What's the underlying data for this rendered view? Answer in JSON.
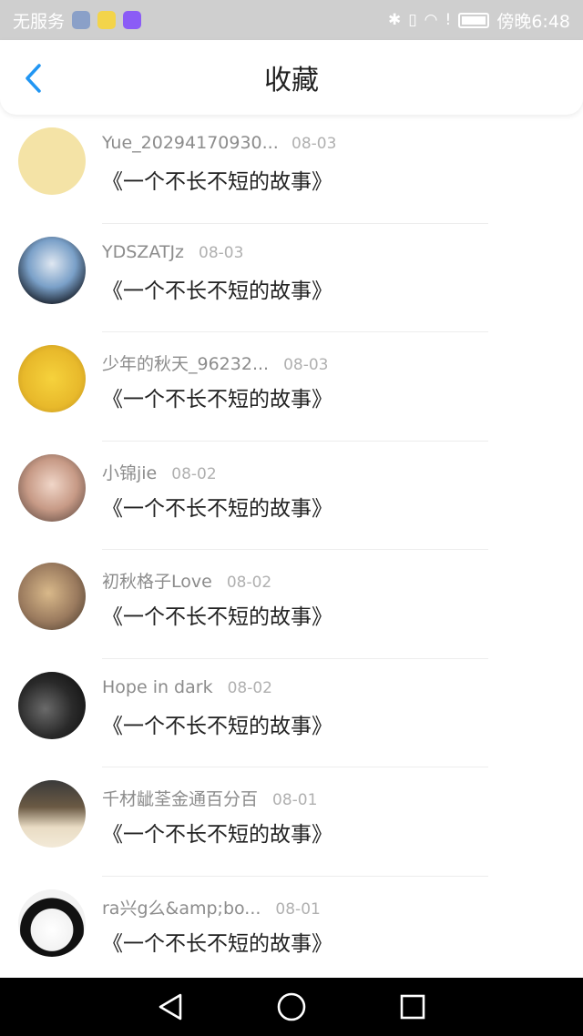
{
  "status_bar": {
    "carrier": "无服务",
    "time": "傍晚6:48",
    "icons": [
      "bluetooth-icon",
      "vibrate-icon",
      "wifi-icon",
      "alert-icon",
      "battery-icon"
    ]
  },
  "header": {
    "title": "收藏",
    "back_icon": "chevron-left-icon",
    "accent_color": "#2196f3"
  },
  "items": [
    {
      "username": "Yue_20294170930...",
      "date": "08-03",
      "title": "《一个不长不短的故事》",
      "avatar_color": "#f4e3a6"
    },
    {
      "username": "YDSZATJz",
      "date": "08-03",
      "title": "《一个不长不短的故事》",
      "avatar_color": "#7aa0c8"
    },
    {
      "username": "少年的秋天_96232...",
      "date": "08-03",
      "title": "《一个不长不短的故事》",
      "avatar_color": "#e8b92b"
    },
    {
      "username": "小锦jie",
      "date": "08-02",
      "title": "《一个不长不短的故事》",
      "avatar_color": "#c79a86"
    },
    {
      "username": "初秋格子Love",
      "date": "08-02",
      "title": "《一个不长不短的故事》",
      "avatar_color": "#9a7a5e"
    },
    {
      "username": "Hope in dark",
      "date": "08-02",
      "title": "《一个不长不短的故事》",
      "avatar_color": "#2a2a2a"
    },
    {
      "username": "千材龇荃金通百分百",
      "date": "08-01",
      "title": "《一个不长不短的故事》",
      "avatar_color": "#d8c6a8"
    },
    {
      "username": "ra兴g么&amp;bo...",
      "date": "08-01",
      "title": "《一个不长不短的故事》",
      "avatar_color": "#f2f2f2"
    }
  ],
  "nav_bar": {
    "buttons": [
      "back-triangle-icon",
      "home-circle-icon",
      "recents-square-icon"
    ]
  }
}
